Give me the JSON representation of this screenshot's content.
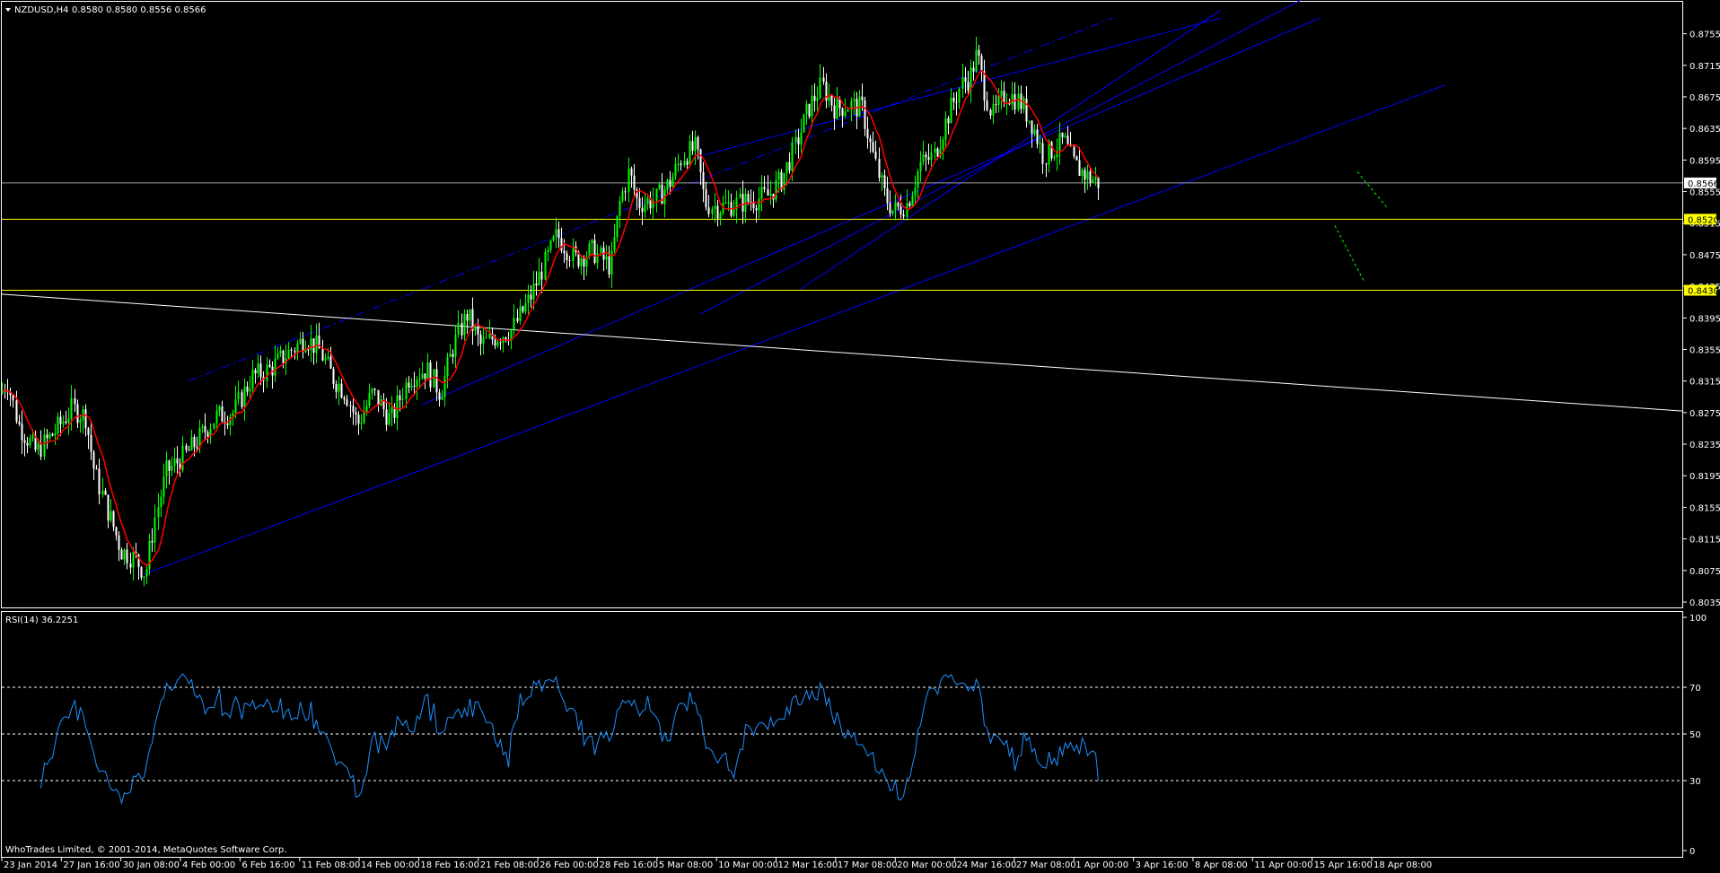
{
  "header": {
    "menu_icon": "triangle-down-icon",
    "symbol": "NZDUSD,H4",
    "ohlc": "0.8580 0.8580 0.8556 0.8566"
  },
  "rsi_header": "RSI(14) 36.2251",
  "copyright": "WhoTrades Limited, © 2001-2014, MetaQuotes Software Corp.",
  "colors": {
    "background": "#000000",
    "bull_candle": "#00ff00",
    "bear_candle": "#ffffff",
    "moving_average": "#ff0000",
    "trendline": "#0000ff",
    "level_line": "#ffff00",
    "rsi_line": "#1e90ff",
    "last_price_line": "#a0a0a0",
    "projection": "#00ff00"
  },
  "price_axis_ticks": [
    "0.8755",
    "0.8715",
    "0.8675",
    "0.8635",
    "0.8595",
    "0.8555",
    "0.8515",
    "0.8475",
    "0.8435",
    "0.8395",
    "0.8355",
    "0.8315",
    "0.8275",
    "0.8235",
    "0.8195",
    "0.8155",
    "0.8115",
    "0.8075",
    "0.8035"
  ],
  "price_tags": {
    "last": "0.8566",
    "level_1": "0.8520",
    "level_2": "0.8430"
  },
  "rsi_axis_ticks": [
    "100",
    "70",
    "50",
    "30",
    "0"
  ],
  "time_axis_ticks": [
    "23 Jan 2014",
    "27 Jan 16:00",
    "30 Jan 08:00",
    "4 Feb 00:00",
    "6 Feb 16:00",
    "11 Feb 08:00",
    "14 Feb 00:00",
    "18 Feb 16:00",
    "21 Feb 08:00",
    "26 Feb 00:00",
    "28 Feb 16:00",
    "5 Mar 08:00",
    "10 Mar 00:00",
    "12 Mar 16:00",
    "17 Mar 08:00",
    "20 Mar 00:00",
    "24 Mar 16:00",
    "27 Mar 08:00",
    "1 Apr 00:00",
    "3 Apr 16:00",
    "8 Apr 08:00",
    "11 Apr 00:00",
    "15 Apr 16:00",
    "18 Apr 08:00"
  ],
  "chart_data": {
    "type": "candlestick",
    "symbol": "NZDUSD",
    "timeframe": "H4",
    "ylim": [
      0.8035,
      0.8775
    ],
    "levels": [
      0.8566,
      0.852,
      0.843
    ],
    "price_path": [
      [
        0,
        0.83
      ],
      [
        8,
        0.8315
      ],
      [
        20,
        0.826
      ],
      [
        40,
        0.8225
      ],
      [
        60,
        0.825
      ],
      [
        80,
        0.828
      ],
      [
        95,
        0.827
      ],
      [
        105,
        0.82
      ],
      [
        120,
        0.815
      ],
      [
        135,
        0.81
      ],
      [
        150,
        0.809
      ],
      [
        162,
        0.807
      ],
      [
        172,
        0.814
      ],
      [
        185,
        0.82
      ],
      [
        205,
        0.822
      ],
      [
        220,
        0.824
      ],
      [
        240,
        0.827
      ],
      [
        260,
        0.8275
      ],
      [
        280,
        0.832
      ],
      [
        300,
        0.833
      ],
      [
        320,
        0.835
      ],
      [
        340,
        0.837
      ],
      [
        355,
        0.8355
      ],
      [
        370,
        0.832
      ],
      [
        385,
        0.83
      ],
      [
        398,
        0.826
      ],
      [
        415,
        0.83
      ],
      [
        435,
        0.8265
      ],
      [
        455,
        0.832
      ],
      [
        475,
        0.833
      ],
      [
        490,
        0.83
      ],
      [
        505,
        0.836
      ],
      [
        520,
        0.84
      ],
      [
        535,
        0.836
      ],
      [
        550,
        0.837
      ],
      [
        570,
        0.838
      ],
      [
        590,
        0.842
      ],
      [
        605,
        0.846
      ],
      [
        620,
        0.85
      ],
      [
        640,
        0.847
      ],
      [
        660,
        0.848
      ],
      [
        680,
        0.846
      ],
      [
        690,
        0.854
      ],
      [
        700,
        0.858
      ],
      [
        710,
        0.854
      ],
      [
        730,
        0.8545
      ],
      [
        745,
        0.8565
      ],
      [
        760,
        0.86
      ],
      [
        775,
        0.861
      ],
      [
        785,
        0.854
      ],
      [
        800,
        0.8535
      ],
      [
        820,
        0.854
      ],
      [
        840,
        0.8545
      ],
      [
        855,
        0.855
      ],
      [
        870,
        0.857
      ],
      [
        885,
        0.861
      ],
      [
        900,
        0.866
      ],
      [
        915,
        0.869
      ],
      [
        930,
        0.866
      ],
      [
        945,
        0.8665
      ],
      [
        960,
        0.866
      ],
      [
        970,
        0.861
      ],
      [
        985,
        0.855
      ],
      [
        995,
        0.853
      ],
      [
        1010,
        0.854
      ],
      [
        1025,
        0.859
      ],
      [
        1040,
        0.86
      ],
      [
        1055,
        0.865
      ],
      [
        1070,
        0.869
      ],
      [
        1080,
        0.87
      ],
      [
        1088,
        0.873
      ],
      [
        1095,
        0.869
      ],
      [
        1105,
        0.865
      ],
      [
        1120,
        0.868
      ],
      [
        1135,
        0.867
      ],
      [
        1150,
        0.864
      ],
      [
        1162,
        0.86
      ],
      [
        1175,
        0.861
      ],
      [
        1185,
        0.862
      ],
      [
        1195,
        0.859
      ],
      [
        1210,
        0.8575
      ],
      [
        1224,
        0.8566
      ]
    ],
    "rsi": {
      "period": 14,
      "last": 36.2251,
      "levels": [
        70,
        50,
        30
      ],
      "range": [
        0,
        100
      ]
    }
  }
}
